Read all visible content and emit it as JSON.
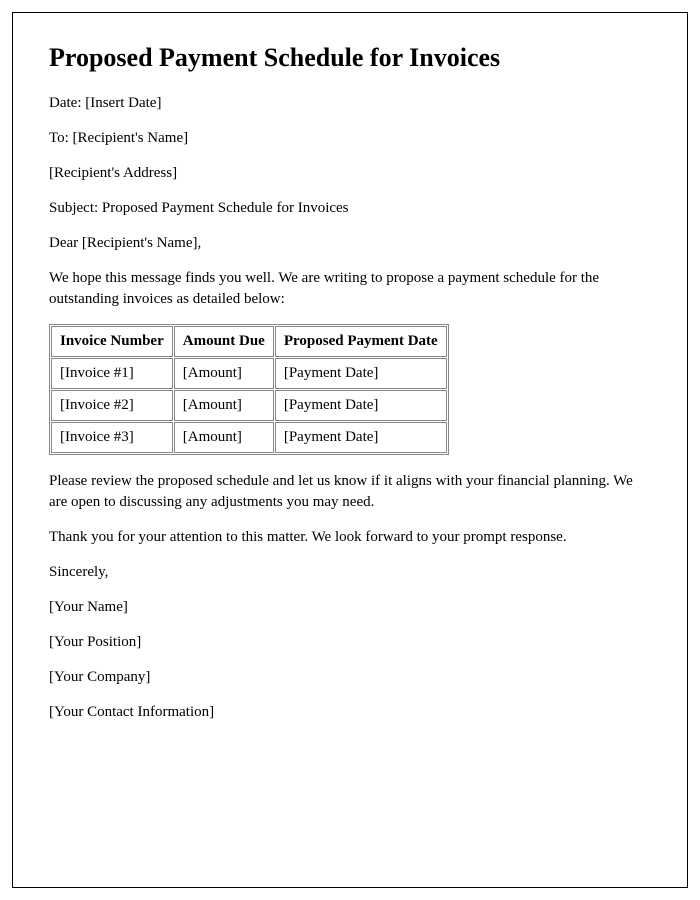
{
  "title": "Proposed Payment Schedule for Invoices",
  "date_line": "Date: [Insert Date]",
  "to_line": "To: [Recipient's Name]",
  "address_line": "[Recipient's Address]",
  "subject_line": "Subject: Proposed Payment Schedule for Invoices",
  "salutation": "Dear [Recipient's Name],",
  "intro": "We hope this message finds you well. We are writing to propose a payment schedule for the outstanding invoices as detailed below:",
  "table": {
    "headers": [
      "Invoice Number",
      "Amount Due",
      "Proposed Payment Date"
    ],
    "rows": [
      [
        "[Invoice #1]",
        "[Amount]",
        "[Payment Date]"
      ],
      [
        "[Invoice #2]",
        "[Amount]",
        "[Payment Date]"
      ],
      [
        "[Invoice #3]",
        "[Amount]",
        "[Payment Date]"
      ]
    ]
  },
  "review_para": "Please review the proposed schedule and let us know if it aligns with your financial planning. We are open to discussing any adjustments you may need.",
  "thanks_para": "Thank you for your attention to this matter. We look forward to your prompt response.",
  "closing": "Sincerely,",
  "sender_name": "[Your Name]",
  "sender_position": "[Your Position]",
  "sender_company": "[Your Company]",
  "sender_contact": "[Your Contact Information]"
}
